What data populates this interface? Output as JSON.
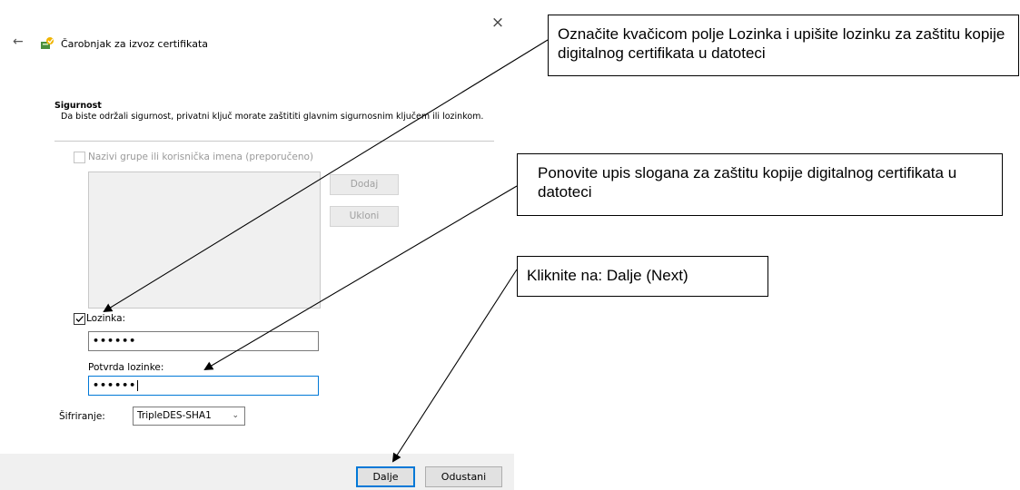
{
  "dialog": {
    "close_glyph": "×",
    "back_glyph": "←",
    "title": "Čarobnjak za izvoz certifikata",
    "section_title": "Sigurnost",
    "section_desc": "Da biste održali sigurnost, privatni ključ morate zaštititi glavnim sigurnosnim ključem ili lozinkom.",
    "groups_checkbox_label": "Nazivi grupe ili korisnička imena (preporučeno)",
    "groups_checkbox_checked": false,
    "add_button": "Dodaj",
    "remove_button": "Ukloni",
    "password_checkbox_label": "Lozinka:",
    "password_checkbox_checked": true,
    "password_value": "••••••",
    "confirm_label": "Potvrda lozinke:",
    "confirm_value": "••••••",
    "encryption_label": "Šifriranje:",
    "encryption_value": "TripleDES-SHA1",
    "next_button": "Dalje",
    "cancel_button": "Odustani"
  },
  "annotations": {
    "callout_password": "Označite kvačicom polje Lozinka i upišite lozinku za zaštitu kopije digitalnog certifikata u datoteci",
    "callout_confirm": "Ponovite upis slogana za zaštitu kopije digitalnog certifikata u datoteci",
    "callout_next": "Kliknite na: Dalje (Next)"
  },
  "colors": {
    "accent": "#0078d7",
    "footer_bg": "#f0f0f0",
    "disabled_text": "#a0a0a0"
  }
}
